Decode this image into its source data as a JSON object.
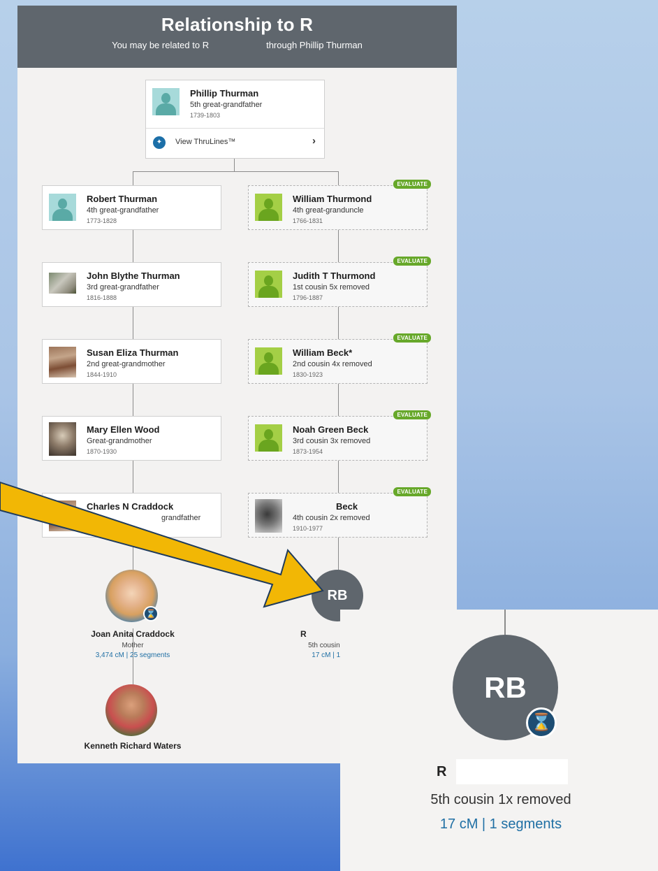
{
  "header": {
    "title": "Relationship to R",
    "subtitle_prefix": "You may be related to R",
    "subtitle_suffix": "through Phillip Thurman"
  },
  "ancestor": {
    "name": "Phillip Thurman",
    "relation": "5th great-grandfather",
    "dates": "1739-1803",
    "thrulines_label": "View ThruLines™",
    "thrulines_icon": "thrulines-icon",
    "chevron": "›"
  },
  "evaluate_label": "EVALUATE",
  "left_line": [
    {
      "name": "Robert Thurman",
      "relation": "4th great-grandfather",
      "dates": "1773-1828",
      "avatar": "silhouette-blue"
    },
    {
      "name": "John Blythe Thurman",
      "relation": "3rd great-grandfather",
      "dates": "1816-1888",
      "avatar": "photo"
    },
    {
      "name": "Susan Eliza Thurman",
      "relation": "2nd great-grandmother",
      "dates": "1844-1910",
      "avatar": "photo"
    },
    {
      "name": "Mary Ellen Wood",
      "relation": "Great-grandmother",
      "dates": "1870-1930",
      "avatar": "photo"
    },
    {
      "name": "Charles N Craddock",
      "relation": "grandfather",
      "dates": "",
      "avatar": "photo"
    }
  ],
  "right_line": [
    {
      "name": "William Thurmond",
      "relation": "4th great-granduncle",
      "dates": "1766-1831",
      "avatar": "silhouette-green"
    },
    {
      "name": "Judith T Thurmond",
      "relation": "1st cousin 5x removed",
      "dates": "1796-1887",
      "avatar": "silhouette-green"
    },
    {
      "name": "William Beck*",
      "relation": "2nd cousin 4x removed",
      "dates": "1830-1923",
      "avatar": "silhouette-green"
    },
    {
      "name": "Noah Green Beck",
      "relation": "3rd cousin 3x removed",
      "dates": "1873-1954",
      "avatar": "silhouette-green"
    },
    {
      "name": "Beck",
      "relation": "4th cousin 2x removed",
      "dates": "1910-1977",
      "avatar": "photo"
    }
  ],
  "mother": {
    "name": "Joan Anita Craddock",
    "relation": "Mother",
    "dna": "3,474 cM | 25 segments"
  },
  "user": {
    "name": "Kenneth Richard Waters"
  },
  "match": {
    "initials": "RB",
    "name": "R",
    "relation": "5th cousin 1",
    "dna": "17 cM | 1 s"
  },
  "zoom": {
    "initials": "RB",
    "name": "R",
    "relation": "5th cousin 1x removed",
    "dna": "17 cM | 1 segments"
  },
  "colors": {
    "header_bg": "#5f666d",
    "evaluate_green": "#67a82a",
    "link_blue": "#1f6fa4",
    "arrow_fill": "#f2b705"
  }
}
